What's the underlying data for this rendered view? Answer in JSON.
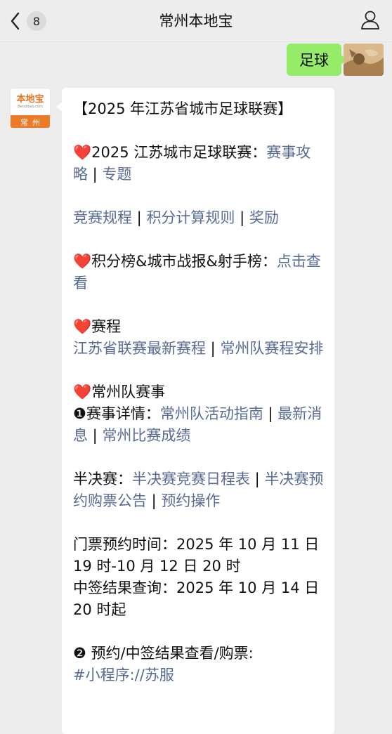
{
  "header": {
    "badge": "8",
    "title": "常州本地宝"
  },
  "sent_message": {
    "text": "足球"
  },
  "sender_avatar": {
    "logo": "本地宝",
    "sub": "Bendibao.com",
    "city": "常州"
  },
  "article": {
    "title": "【2025 年江苏省城市足球联赛】",
    "heart": "❤️",
    "sec1_text": "2025 江苏城市足球联赛：",
    "sec1_link1": "赛事攻略",
    "sep": " | ",
    "sec1_link2": "专题",
    "rules_link1": "竞赛规程",
    "rules_link2": "积分计算规则",
    "rules_link3": "奖励",
    "sec2_text": "积分榜&城市战报&射手榜：",
    "sec2_link": "点击查看",
    "sec3_text": "赛程",
    "sec3_link1": "江苏省联赛最新赛程",
    "sec3_link2": "常州队赛程安排",
    "sec4_text": "常州队赛事",
    "item1_num": "❶",
    "item1_text": "赛事详情：",
    "item1_link1": "常州队活动指南",
    "item1_link2": "最新消息",
    "item1_link3": "常州比赛成绩",
    "semi_text": "半决赛：",
    "semi_link1": "半决赛竞赛日程表",
    "semi_link2": "半决赛预约购票公告",
    "semi_link3": "预约操作",
    "ticket_time_1": "门票预约时间：2025 年 10 月 11 日",
    "ticket_time_2": "19 时-10 月 12 日 20 时",
    "result_time_1": "中签结果查询：2025 年 10 月 14 日",
    "result_time_2": "20 时起",
    "item2_num": "❷",
    "item2_text": " 预约/中签结果查看/购票:",
    "item2_link": "#小程序://苏服"
  }
}
